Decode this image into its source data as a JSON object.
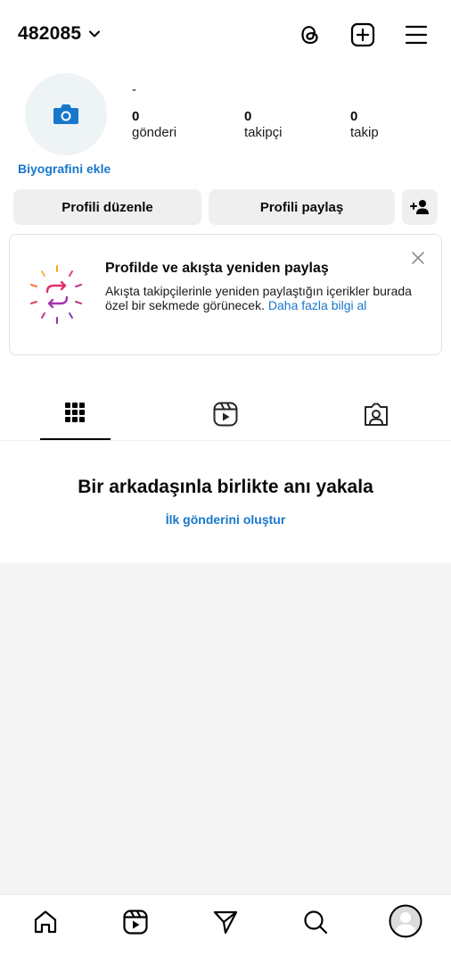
{
  "header": {
    "username": "482085"
  },
  "profile": {
    "display_name": "-",
    "stats": [
      {
        "value": "0",
        "label": "gönderi"
      },
      {
        "value": "0",
        "label": "takipçi"
      },
      {
        "value": "0",
        "label": "takip"
      }
    ],
    "bio_link": "Biyografini ekle"
  },
  "actions": {
    "edit_label": "Profili düzenle",
    "share_label": "Profili paylaş"
  },
  "card": {
    "title": "Profilde ve akışta yeniden paylaş",
    "text": "Akışta takipçilerinle yeniden paylaştığın içerikler burada özel bir sekmede görünecek.",
    "link": "Daha fazla bilgi al"
  },
  "empty_state": {
    "title": "Bir arkadaşınla birlikte anı yakala",
    "link": "İlk gönderini oluştur"
  },
  "icons": {
    "header": [
      "threads-icon",
      "add-post-icon",
      "menu-icon"
    ],
    "tabs": [
      "grid-icon",
      "reels-icon",
      "tagged-icon"
    ],
    "nav": [
      "home-icon",
      "reels-icon",
      "direct-icon",
      "search-icon",
      "profile-avatar-icon"
    ]
  },
  "colors": {
    "accent": "#1877cc",
    "button_bg": "#efefef",
    "empty_bg": "#f4f4f4"
  }
}
